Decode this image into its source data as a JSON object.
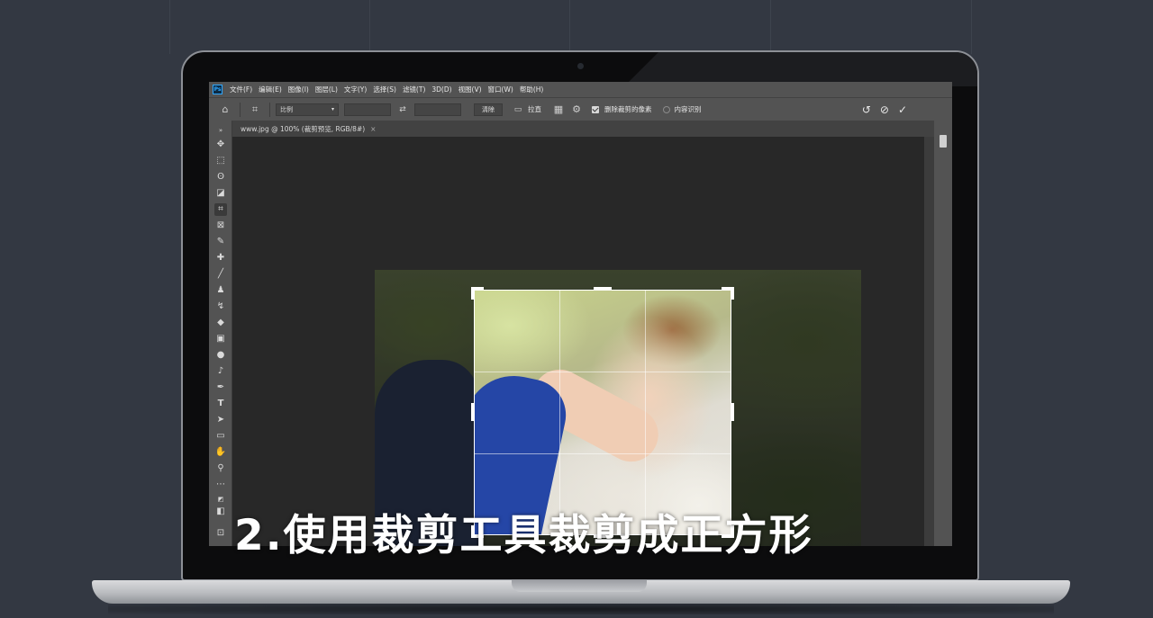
{
  "menubar": {
    "logo": "Ps",
    "items": [
      "文件(F)",
      "编辑(E)",
      "图像(I)",
      "图层(L)",
      "文字(Y)",
      "选择(S)",
      "滤镜(T)",
      "3D(D)",
      "视图(V)",
      "窗口(W)",
      "帮助(H)"
    ]
  },
  "options": {
    "ratio": "比例",
    "clear": "清除",
    "straighten": "拉直",
    "delete_cropped": "删除裁剪的像素",
    "content_aware": "内容识别"
  },
  "document_tab": {
    "title": "www.jpg @ 100% (裁剪预览, RGB/8#)",
    "close": "×"
  },
  "subtitle": "2.使用裁剪工具裁剪成正方形"
}
